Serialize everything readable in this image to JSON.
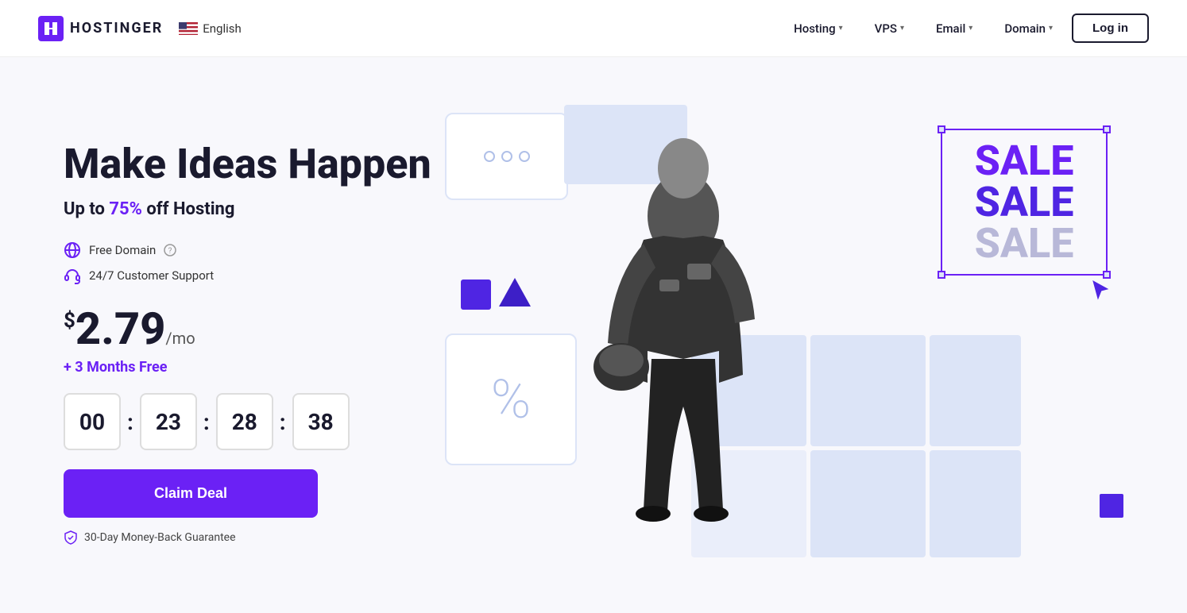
{
  "navbar": {
    "logo_text": "HOSTINGER",
    "lang_label": "English",
    "nav_items": [
      {
        "label": "Hosting",
        "has_dropdown": true
      },
      {
        "label": "VPS",
        "has_dropdown": true
      },
      {
        "label": "Email",
        "has_dropdown": true
      },
      {
        "label": "Domain",
        "has_dropdown": true
      }
    ],
    "login_label": "Log in"
  },
  "hero": {
    "title": "Make Ideas Happen",
    "subtitle_prefix": "Up to ",
    "subtitle_highlight": "75%",
    "subtitle_suffix": " off Hosting",
    "features": [
      {
        "label": "Free Domain",
        "icon": "globe-icon",
        "has_info": true
      },
      {
        "label": "24/7 Customer Support",
        "icon": "headset-icon"
      }
    ],
    "price_dollar": "$",
    "price_value": "2.79",
    "price_period": "/mo",
    "free_months": "+ 3 Months Free",
    "countdown": {
      "hours": "00",
      "minutes": "23",
      "seconds": "28",
      "frames": "38"
    },
    "cta_label": "Claim Deal",
    "guarantee_label": "30-Day Money-Back Guarantee"
  },
  "sale": {
    "lines": [
      "SALE",
      "SALE",
      "SALE"
    ]
  },
  "colors": {
    "brand_purple": "#6b21f5",
    "dark": "#1a1a2e",
    "deco_light": "#dce4f7"
  }
}
